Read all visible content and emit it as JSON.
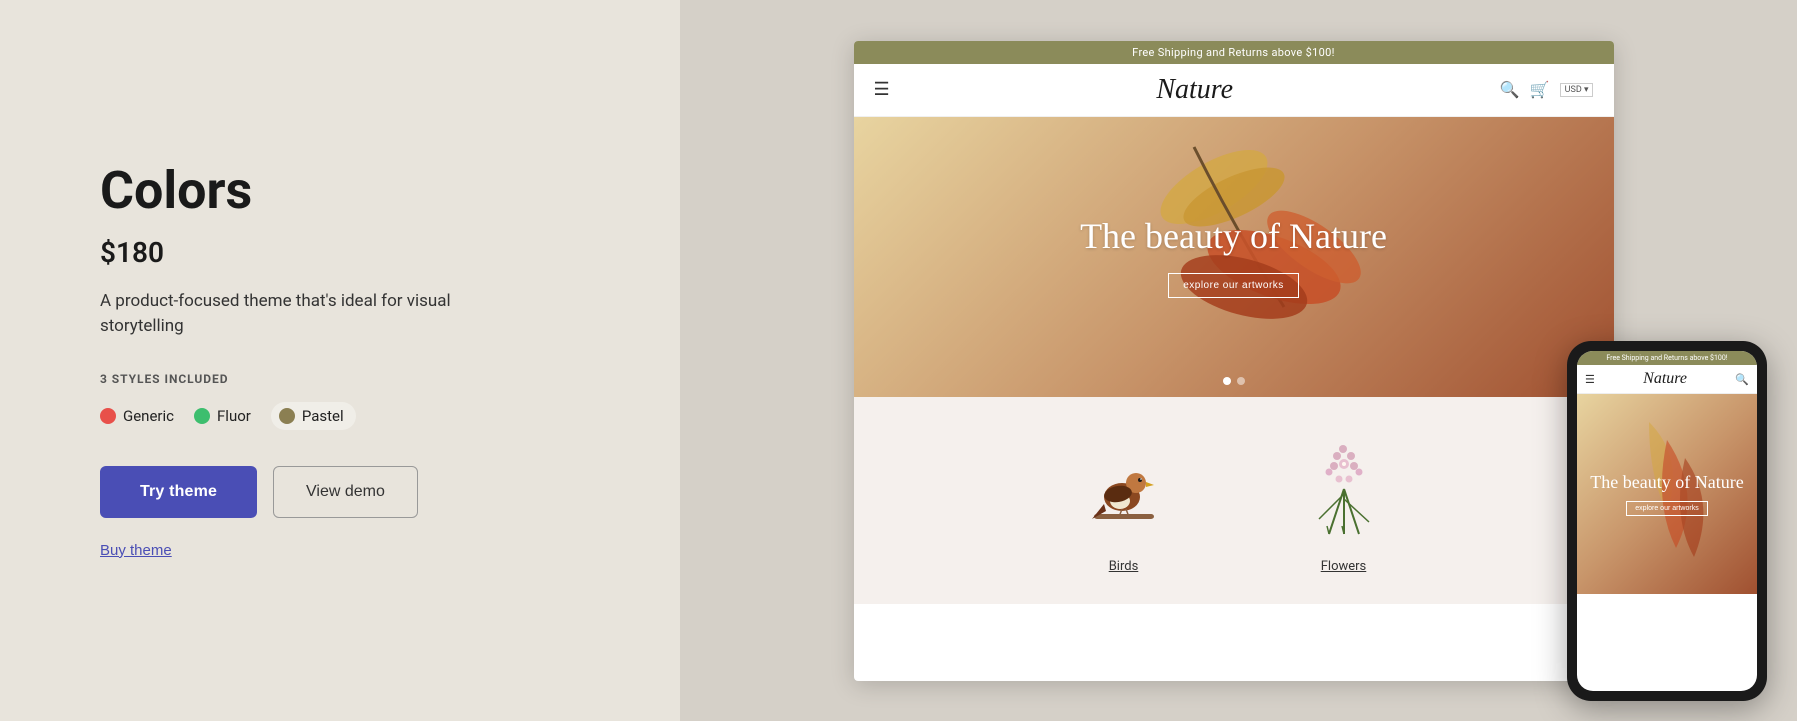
{
  "left": {
    "title": "Colors",
    "price": "$180",
    "description": "A product-focused theme that's ideal for visual storytelling",
    "styles_label": "3 STYLES INCLUDED",
    "styles": [
      {
        "name": "Generic",
        "color": "#e8504a",
        "active": false
      },
      {
        "name": "Fluor",
        "color": "#3dbe6e",
        "active": false
      },
      {
        "name": "Pastel",
        "color": "#8b7f52",
        "active": true
      }
    ],
    "try_button": "Try theme",
    "demo_button": "View demo",
    "buy_link": "Buy theme"
  },
  "preview": {
    "desktop": {
      "announce": "Free Shipping and Returns above $100!",
      "logo": "Nature",
      "hero_title": "The beauty of Nature",
      "hero_btn": "explore our artworks",
      "categories": [
        {
          "label": "Birds"
        },
        {
          "label": "Flowers"
        }
      ]
    },
    "mobile": {
      "announce": "Free Shipping and Returns above $100!",
      "logo": "Nature",
      "hero_title": "The beauty of Nature",
      "hero_btn": "explore our artworks"
    }
  }
}
